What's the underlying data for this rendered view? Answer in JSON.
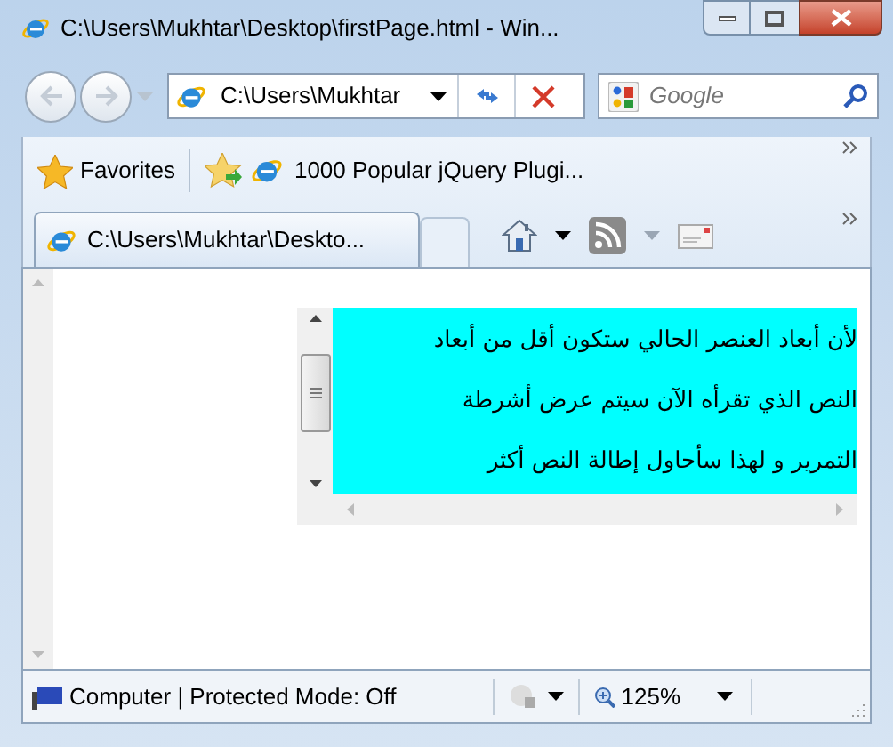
{
  "window": {
    "title": "C:\\Users\\Mukhtar\\Desktop\\firstPage.html - Win..."
  },
  "address_bar": {
    "value": "C:\\Users\\Mukhtar"
  },
  "search": {
    "placeholder": "Google"
  },
  "favorites_bar": {
    "label": "Favorites",
    "items": [
      "1000 Popular jQuery Plugi..."
    ]
  },
  "tabs": [
    {
      "label": "C:\\Users\\Mukhtar\\Deskto...",
      "selected": true
    }
  ],
  "content": {
    "lines": [
      "لأن أبعاد العنصر الحالي ستكون أقل من أبعاد",
      "النص الذي تقرأه الآن سيتم عرض أشرطة",
      "التمرير و لهذا سأحاول إطالة النص أكثر"
    ]
  },
  "status_bar": {
    "text": "Computer | Protected Mode: Off",
    "zoom": "125%"
  }
}
